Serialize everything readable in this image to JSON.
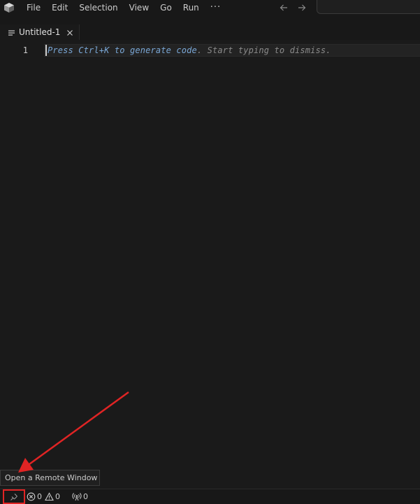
{
  "menu": {
    "items": [
      "File",
      "Edit",
      "Selection",
      "View",
      "Go",
      "Run"
    ],
    "more": "···"
  },
  "icons": {
    "app_logo": "cube-logo-icon",
    "back": "arrow-left-icon",
    "forward": "arrow-right-icon",
    "tab_file": "text-lines-icon",
    "tab_close": "close-icon",
    "remote": "remote-connection-icon",
    "errors": "error-circle-icon",
    "warnings": "warning-triangle-icon",
    "ports": "broadcast-icon"
  },
  "tabs": [
    {
      "label": "Untitled-1"
    }
  ],
  "editor": {
    "line_number": "1",
    "hint_key": "Press Ctrl+K",
    "hint_middle": " to generate code",
    "hint_rest": ". Start typing to dismiss."
  },
  "tooltip": {
    "text": "Open a Remote Window"
  },
  "statusbar": {
    "errors": "0",
    "warnings": "0",
    "ports": "0"
  },
  "colors": {
    "background": "#1a1a1a",
    "annotation": "#e02424",
    "hint_key": "#7aa7d6",
    "hint_text": "#8a8a8a"
  }
}
